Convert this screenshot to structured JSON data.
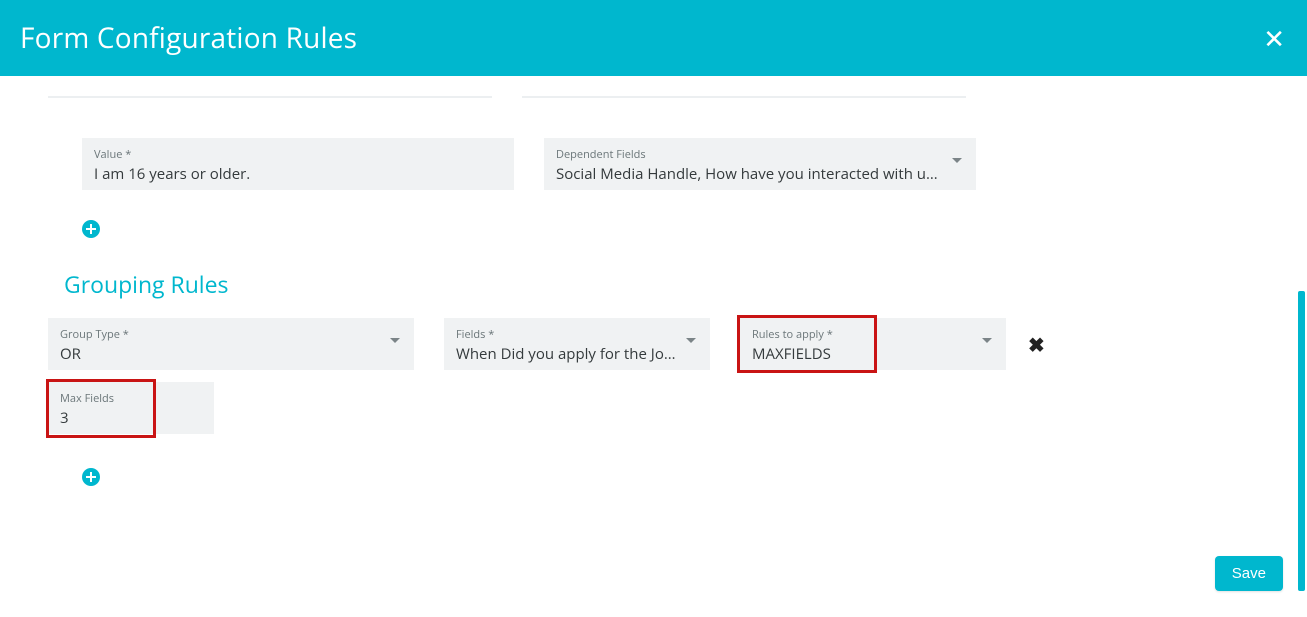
{
  "header": {
    "title": "Form Configuration Rules"
  },
  "value_field": {
    "label": "Value *",
    "value": "I am 16 years or older."
  },
  "dependent_fields": {
    "label": "Dependent Fields",
    "value": "Social Media Handle, How have you interacted with us?, How …"
  },
  "section_title": "Grouping Rules",
  "group_type": {
    "label": "Group Type *",
    "value": "OR"
  },
  "fields": {
    "label": "Fields *",
    "value": "When Did you apply for the Job?, …"
  },
  "rules_to_apply": {
    "label": "Rules to apply *",
    "value": "MAXFIELDS"
  },
  "max_fields": {
    "label": "Max Fields",
    "value": "3"
  },
  "buttons": {
    "save": "Save"
  }
}
